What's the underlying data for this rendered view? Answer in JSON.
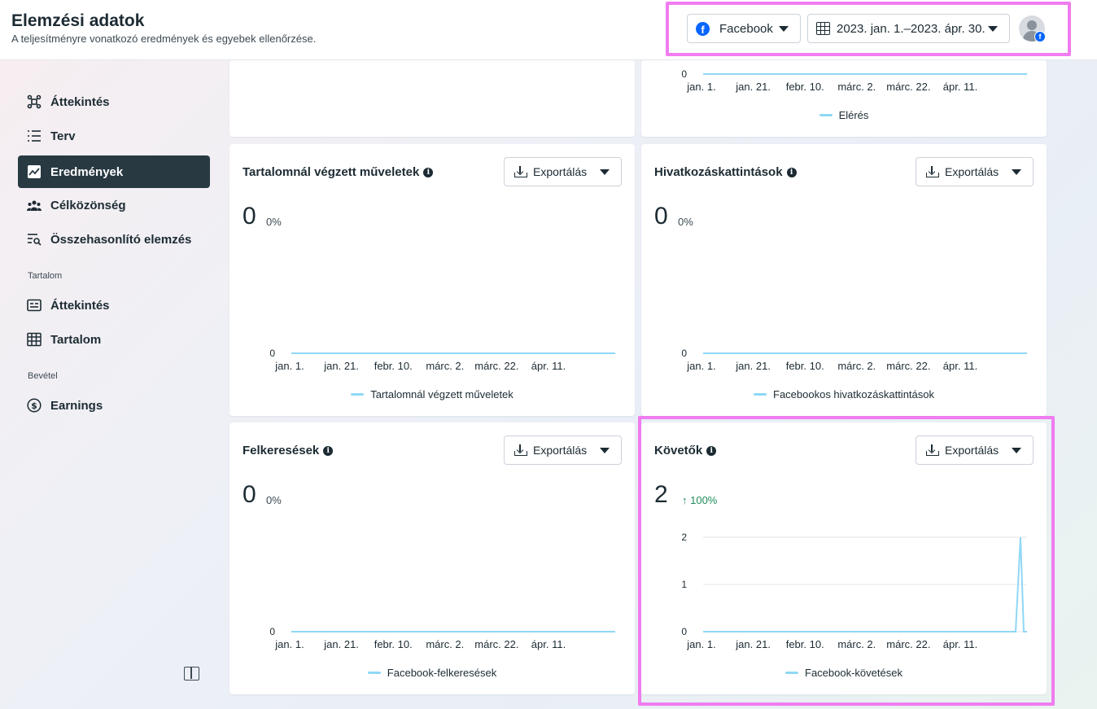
{
  "header": {
    "title": "Elemzési adatok",
    "subtitle": "A teljesítményre vonatkozó eredmények és egyebek ellenőrzése.",
    "platform": "Facebook",
    "date_range": "2023. jan. 1.–2023. ápr. 30."
  },
  "sidebar": {
    "items": [
      {
        "label": "Áttekintés",
        "icon": "overview-icon"
      },
      {
        "label": "Terv",
        "icon": "plan-list-icon"
      },
      {
        "label": "Eredmények",
        "icon": "results-chart-icon"
      },
      {
        "label": "Célközönség",
        "icon": "audience-icon"
      },
      {
        "label": "Összehasonlító elemzés",
        "icon": "benchmark-icon"
      }
    ],
    "section_content": "Tartalom",
    "content_items": [
      {
        "label": "Áttekintés",
        "icon": "content-overview-icon"
      },
      {
        "label": "Tartalom",
        "icon": "table-icon"
      }
    ],
    "section_revenue": "Bevétel",
    "revenue_items": [
      {
        "label": "Earnings",
        "icon": "dollar-icon"
      }
    ]
  },
  "common": {
    "export_label": "Exportálás",
    "x_ticks": [
      "jan. 1.",
      "jan. 21.",
      "febr. 10.",
      "márc. 2.",
      "márc. 22.",
      "ápr. 11."
    ],
    "y_zero": "0",
    "colors": {
      "line": "#8fd8f5",
      "accent": "#283942",
      "up": "#1f8c5a"
    }
  },
  "cards": {
    "reach": {
      "legend": "Elérés"
    },
    "content_actions": {
      "title": "Tartalomnál végzett műveletek",
      "value": "0",
      "change": "0%",
      "legend": "Tartalomnál végzett műveletek"
    },
    "link_clicks": {
      "title": "Hivatkozáskattintások",
      "value": "0",
      "change": "0%",
      "legend": "Facebookos hivatkozáskattintások"
    },
    "searches": {
      "title": "Felkeresések",
      "value": "0",
      "change": "0%",
      "legend": "Facebook-felkeresések"
    },
    "followers": {
      "title": "Követők",
      "value": "2",
      "change": "↑ 100%",
      "legend": "Facebook-követések"
    }
  },
  "chart_data": [
    {
      "type": "line",
      "title": "",
      "x": [
        "jan. 1.",
        "jan. 21.",
        "febr. 10.",
        "márc. 2.",
        "márc. 22.",
        "ápr. 11."
      ],
      "series": [
        {
          "name": "Elérés",
          "values": [
            0,
            0,
            0,
            0,
            0,
            0
          ]
        }
      ],
      "ylim": [
        0,
        0
      ]
    },
    {
      "type": "line",
      "title": "Tartalomnál végzett műveletek",
      "x": [
        "jan. 1.",
        "jan. 21.",
        "febr. 10.",
        "márc. 2.",
        "márc. 22.",
        "ápr. 11."
      ],
      "series": [
        {
          "name": "Tartalomnál végzett műveletek",
          "values": [
            0,
            0,
            0,
            0,
            0,
            0
          ]
        }
      ],
      "ylim": [
        0,
        0
      ]
    },
    {
      "type": "line",
      "title": "Hivatkozáskattintások",
      "x": [
        "jan. 1.",
        "jan. 21.",
        "febr. 10.",
        "márc. 2.",
        "márc. 22.",
        "ápr. 11."
      ],
      "series": [
        {
          "name": "Facebookos hivatkozáskattintások",
          "values": [
            0,
            0,
            0,
            0,
            0,
            0
          ]
        }
      ],
      "ylim": [
        0,
        0
      ]
    },
    {
      "type": "line",
      "title": "Felkeresések",
      "x": [
        "jan. 1.",
        "jan. 21.",
        "febr. 10.",
        "márc. 2.",
        "márc. 22.",
        "ápr. 11."
      ],
      "series": [
        {
          "name": "Facebook-felkeresések",
          "values": [
            0,
            0,
            0,
            0,
            0,
            0
          ]
        }
      ],
      "ylim": [
        0,
        0
      ]
    },
    {
      "type": "line",
      "title": "Követők",
      "x": [
        "jan. 1.",
        "jan. 21.",
        "febr. 10.",
        "márc. 2.",
        "márc. 22.",
        "ápr. 11."
      ],
      "yticks": [
        "0",
        "1",
        "2"
      ],
      "ylim": [
        0,
        2
      ],
      "series": [
        {
          "name": "Facebook-követések",
          "values": [
            0,
            0,
            0,
            0,
            0,
            0,
            2,
            0
          ]
        }
      ]
    }
  ]
}
